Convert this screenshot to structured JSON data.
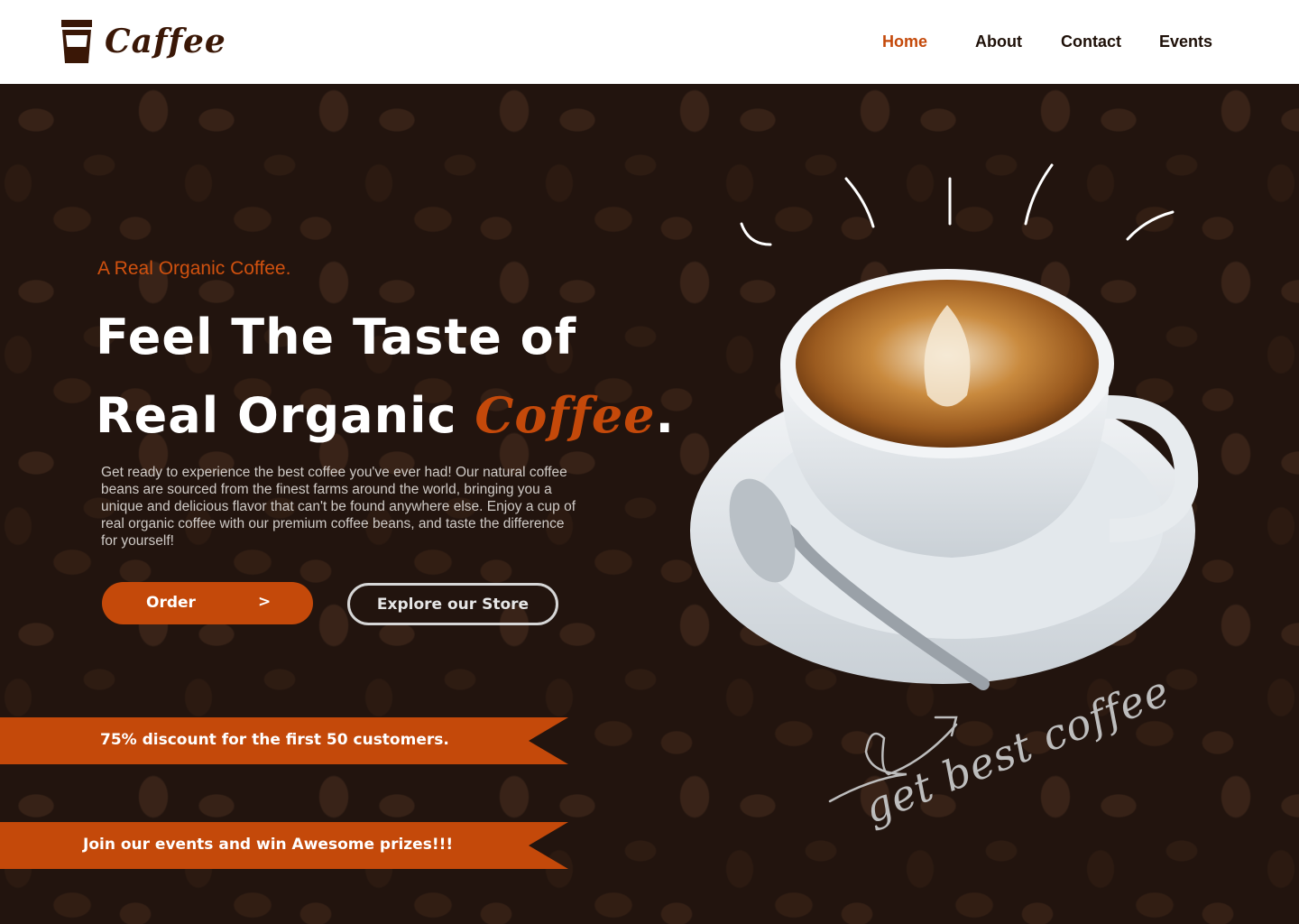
{
  "header": {
    "brand": "Caffee",
    "nav": [
      "Home",
      "About",
      "Contact",
      "Events"
    ],
    "active_nav": "Home"
  },
  "hero": {
    "tagline": "A Real Organic Coffee.",
    "headline_line1": "Feel The Taste of",
    "headline_line2_prefix": "Real Organic ",
    "headline_accent": "Coffee",
    "headline_suffix": ".",
    "description": "Get ready to experience the best coffee you've ever had! Our natural coffee beans are sourced from the finest farms around the world, bringing you a unique and delicious flavor that can't be found anywhere else. Enjoy a cup of real organic coffee with our premium coffee beans, and taste the difference for yourself!",
    "order_label": "Order",
    "order_chevron": ">",
    "explore_label": "Explore our Store",
    "scribble_text": "get best coffee"
  },
  "promos": [
    "75% discount for the first 50 customers.",
    "Join our events and win Awesome prizes!!!"
  ],
  "colors": {
    "accent": "#c4490a",
    "brand_dark": "#3a1706",
    "bean_bg": "#2a1a12"
  },
  "icons": {
    "logo": "coffee-cup-icon",
    "arrow": "scribble-arrow-icon"
  }
}
